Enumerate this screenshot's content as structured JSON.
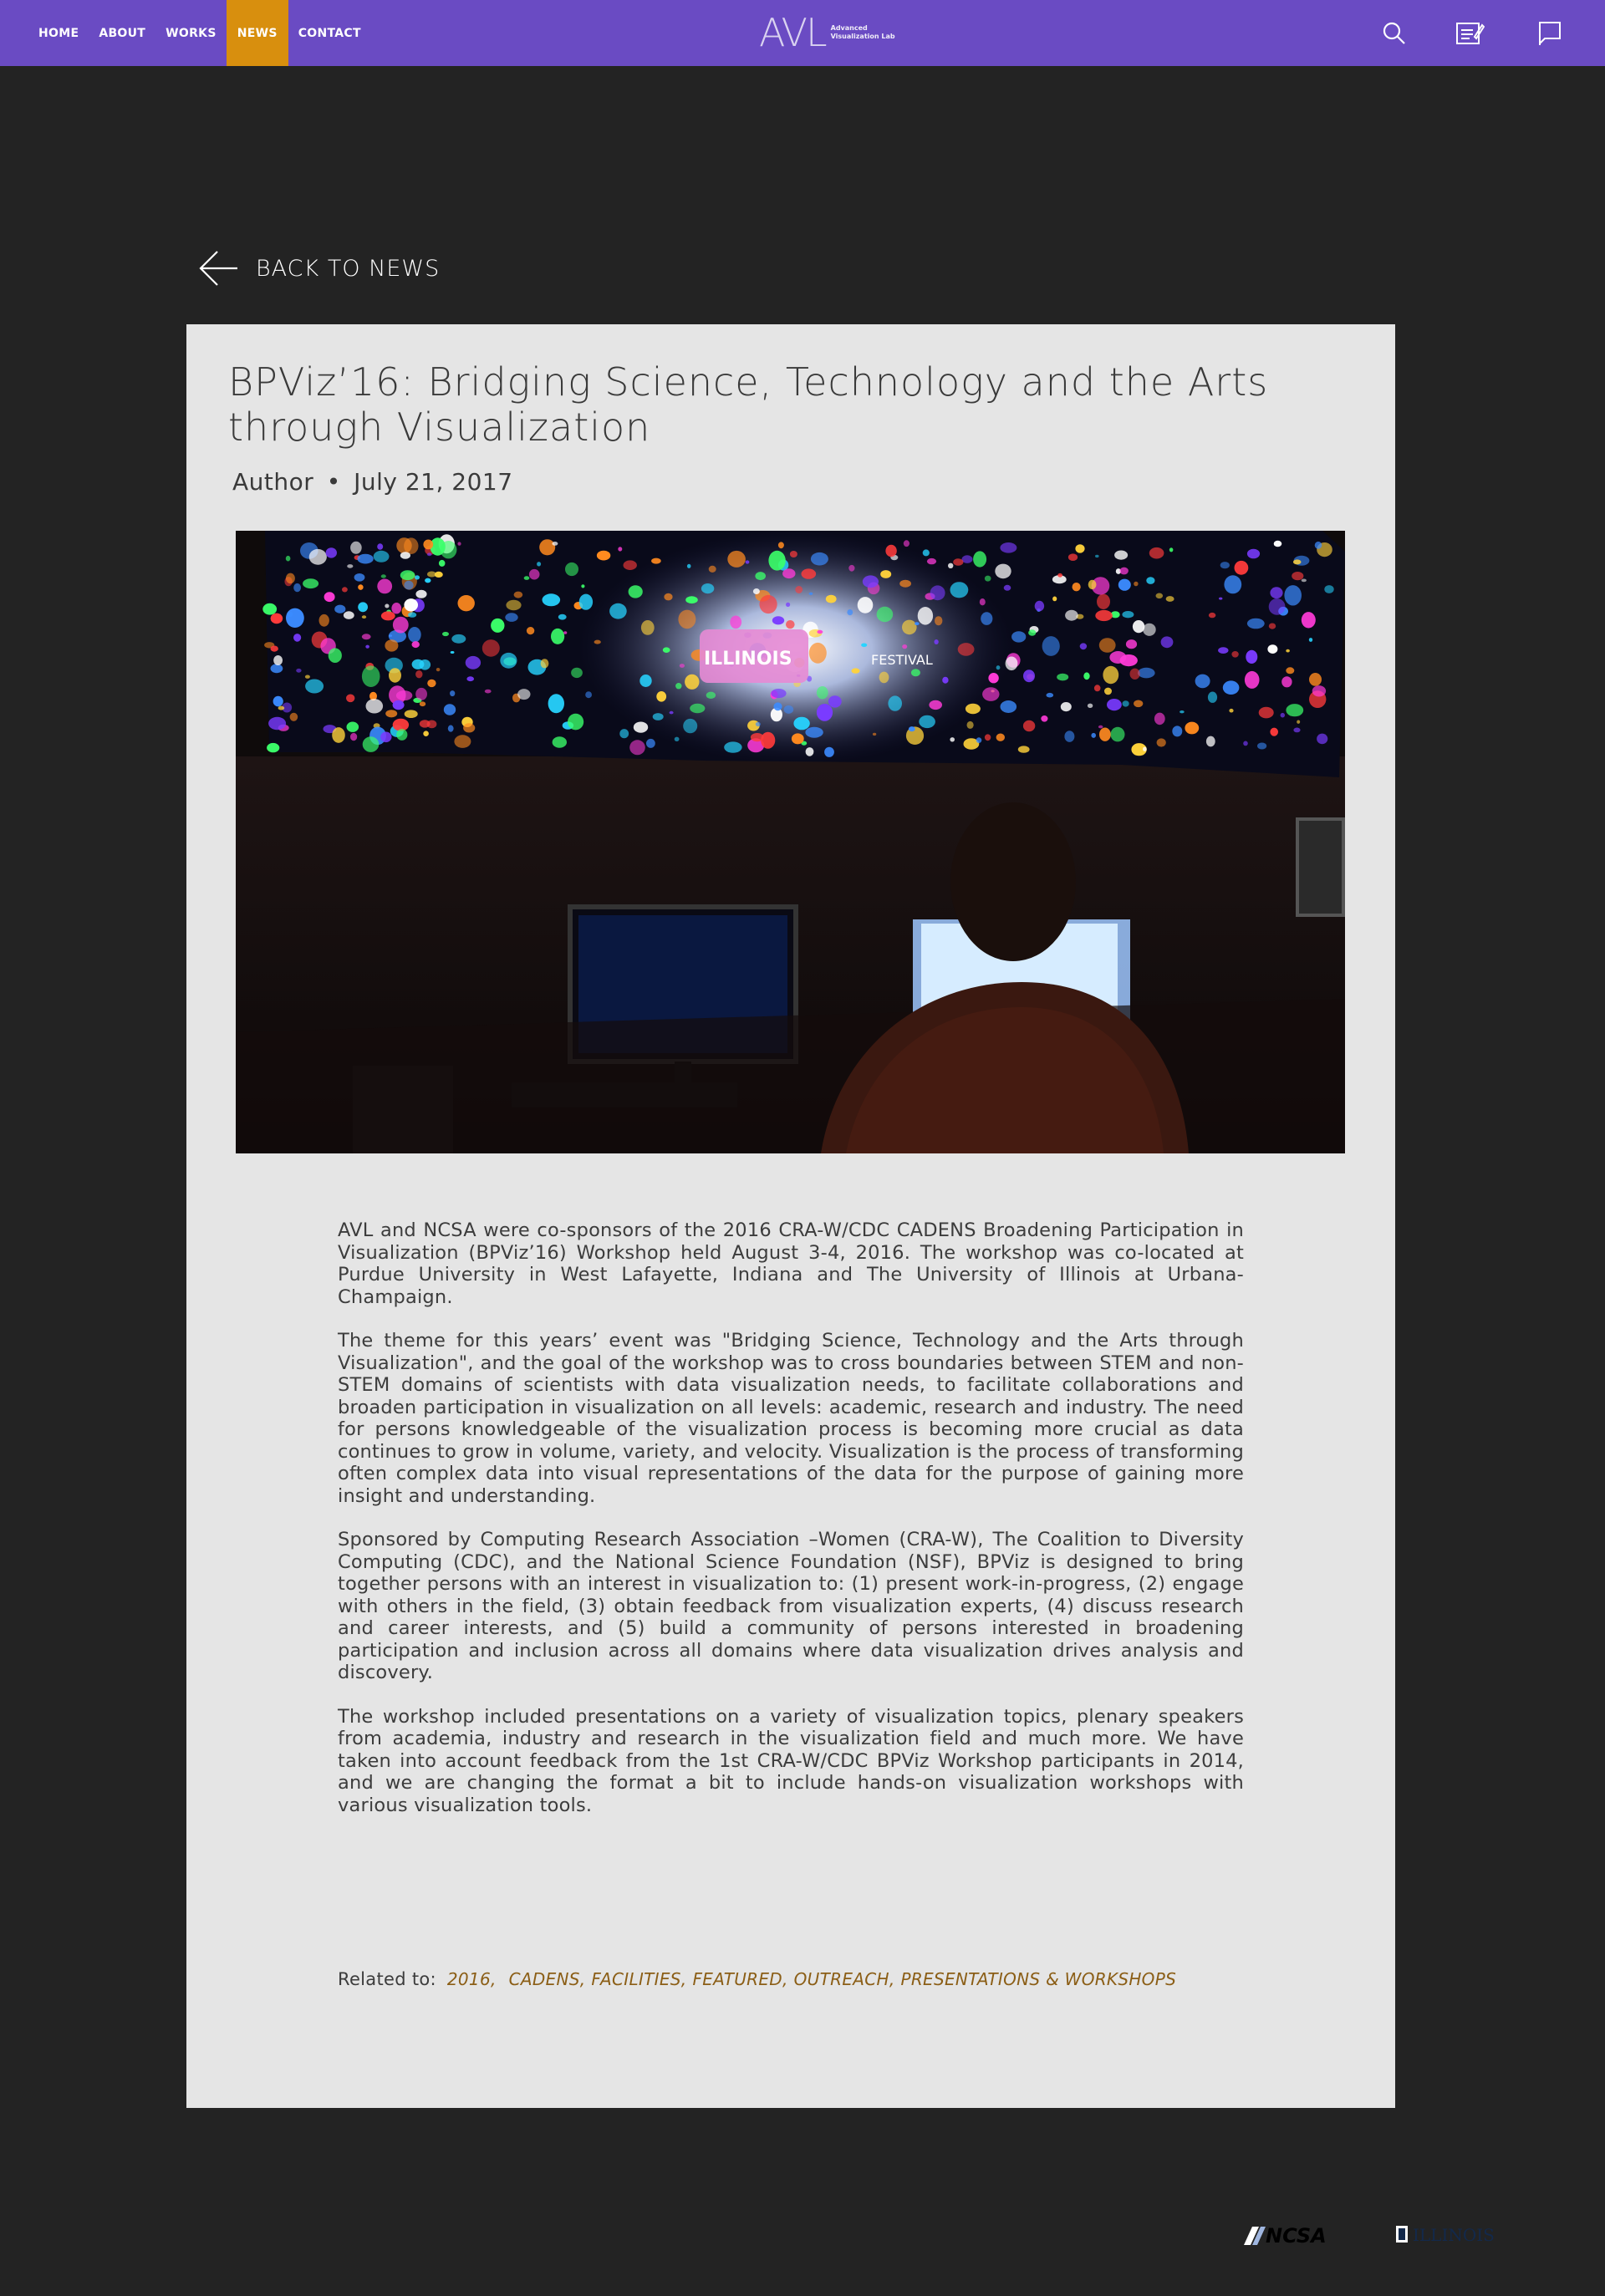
{
  "nav": {
    "links": [
      {
        "label": "HOME"
      },
      {
        "label": "ABOUT"
      },
      {
        "label": "WORKS"
      },
      {
        "label": "NEWS"
      },
      {
        "label": "CONTACT"
      }
    ],
    "active": "NEWS",
    "logo_mark": "AVL",
    "logo_line1": "Advanced",
    "logo_line2": "Visualization Lab",
    "icons": [
      "search-icon",
      "notepad-icon",
      "flag-icon"
    ]
  },
  "back_label": "BACK TO NEWS",
  "article": {
    "title": "BPViz’16: Bridging Science, Technology and the Arts through Visualization",
    "author": "Author",
    "separator": "•",
    "date": "July 21, 2017",
    "hero_banner_text": "ILLINOIS",
    "hero_banner_text2": "FESTIVAL",
    "paragraphs": [
      "AVL and NCSA were co-sponsors of the 2016 CRA-W/CDC CADENS Broadening Participation in Visualization (BPViz’16) Workshop held August 3-4, 2016. The workshop was co-located at Purdue University in West Lafayette, Indiana and The University of Illinois at Urbana-Champaign.",
      "The theme for this years’ event was \"Bridging Science, Technology and the Arts through Visualization\", and the goal of the workshop was to cross boundaries between STEM and non-STEM domains of scientists with data visualization needs, to facilitate collaborations and broaden participation in visualization on all levels: academic, research and industry. The need for persons knowledgeable of the visualization process is becoming more crucial as data continues to grow in volume, variety, and velocity. Visualization is the process of transforming often complex data into visual representations of the data for the purpose of gaining more insight and understanding.",
      "Sponsored by Computing Research Association –Women (CRA-W), The Coalition to Diversity Computing (CDC), and the National Science Foundation (NSF), BPViz is designed to bring together persons with an interest in visualization to: (1) present work-in-progress, (2) engage with others in the field, (3) obtain feedback from visualization experts, (4) discuss research and career interests, and (5) build a community of persons interested in broadening participation and inclusion across all domains where data visualization drives analysis and discovery.",
      "The workshop included presentations on a variety of visualization topics, plenary speakers from academia, industry and research in the visualization field and much more. We have taken into account feedback from the 1st CRA-W/CDC BPViz Workshop participants in 2014, and we are changing  the format a bit to include hands-on visualization workshops with various visualization tools."
    ],
    "related_label": "Related to:",
    "tags": [
      "2016,",
      "CADENS,",
      "FACILITIES,",
      "FEATURED,",
      "OUTREACH,",
      "PRESENTATIONS & WORKSHOPS"
    ]
  },
  "footer": {
    "logo1": "NCSA",
    "logo2": "ILLINOIS"
  },
  "colors": {
    "nav_bg": "#6a4bc3",
    "nav_active": "#d88f0e",
    "page_bg": "#232323",
    "card_bg": "#e5e5e5",
    "tag": "#8b5e16"
  }
}
